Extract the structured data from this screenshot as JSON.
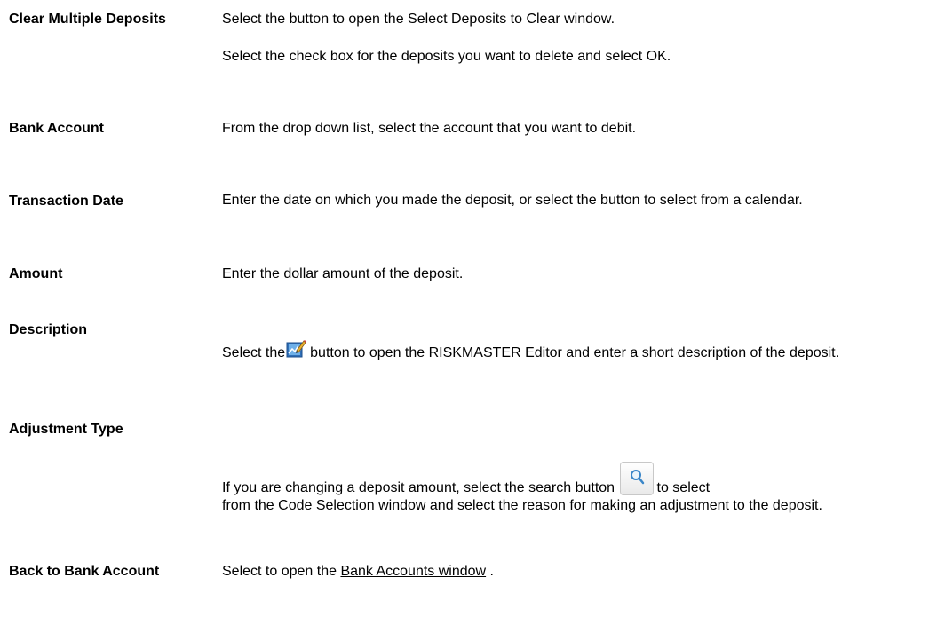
{
  "rows": [
    {
      "term": "Clear Multiple Deposits",
      "desc1": "Select the button to open the Select Deposits to Clear window.",
      "desc2": "Select the check box for the deposits you want to delete and select OK."
    },
    {
      "term": "Bank Account",
      "desc": "From the drop down list, select the account that you want to debit."
    },
    {
      "term": "Transaction Date",
      "desc": "Enter the date on which you made the deposit, or select the button to select from a calendar."
    },
    {
      "term": "Amount",
      "desc": "Enter the dollar amount of the deposit."
    },
    {
      "term": "Description",
      "desc_before": "Select the",
      "desc_after": "button to open the RISKMASTER Editor and enter a short description of the deposit.",
      "icon": "edit-icon"
    },
    {
      "term": "Adjustment Type",
      "desc_line1_before": "If you are changing a deposit amount, select the search button",
      "desc_line1_after": "to select",
      "desc_rest": "from  the Code Selection window and select the reason for making an adjustment to the deposit.",
      "icon": "search-icon"
    },
    {
      "term": "Back to Bank Account",
      "desc_before": "Select to open the",
      "link": "Bank Accounts window",
      "desc_after": " ."
    }
  ],
  "colors": {
    "text": "#000000",
    "background": "#ffffff",
    "icon_button_border": "#c8c8c8"
  }
}
